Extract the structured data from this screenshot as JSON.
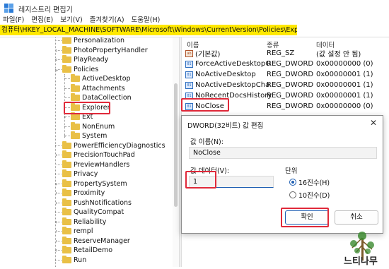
{
  "window": {
    "title": "레지스트리 편집기"
  },
  "menu": [
    "파일(F)",
    "편집(E)",
    "보기(V)",
    "즐겨찾기(A)",
    "도움말(H)"
  ],
  "address": "컴퓨터\\HKEY_LOCAL_MACHINE\\SOFTWARE\\Microsoft\\Windows\\CurrentVersion\\Policies\\Explorer",
  "tree": {
    "items": [
      {
        "label": "Personalization",
        "expander": ""
      },
      {
        "label": "PhotoPropertyHandler",
        "expander": ">"
      },
      {
        "label": "PlayReady",
        "expander": ">"
      },
      {
        "label": "Policies",
        "expander": "v"
      },
      {
        "label": "ActiveDesktop",
        "expander": ""
      },
      {
        "label": "Attachments",
        "expander": ""
      },
      {
        "label": "DataCollection",
        "expander": ""
      },
      {
        "label": "Explorer",
        "expander": ""
      },
      {
        "label": "Ext",
        "expander": ">"
      },
      {
        "label": "NonEnum",
        "expander": ""
      },
      {
        "label": "System",
        "expander": ">"
      },
      {
        "label": "PowerEfficiencyDiagnostics",
        "expander": ""
      },
      {
        "label": "PrecisionTouchPad",
        "expander": ">"
      },
      {
        "label": "PreviewHandlers",
        "expander": ""
      },
      {
        "label": "Privacy",
        "expander": ""
      },
      {
        "label": "PropertySystem",
        "expander": ">"
      },
      {
        "label": "Proximity",
        "expander": ">"
      },
      {
        "label": "PushNotifications",
        "expander": ">"
      },
      {
        "label": "QualityCompat",
        "expander": ""
      },
      {
        "label": "Reliability",
        "expander": ">"
      },
      {
        "label": "rempl",
        "expander": ">"
      },
      {
        "label": "ReserveManager",
        "expander": ">"
      },
      {
        "label": "RetailDemo",
        "expander": ">"
      },
      {
        "label": "Run",
        "expander": ""
      }
    ]
  },
  "list": {
    "headers": {
      "name": "이름",
      "type": "종류",
      "data": "데이터"
    },
    "rows": [
      {
        "name": "(기본값)",
        "type": "REG_SZ",
        "data": "(값 설정 안 됨)",
        "icon": "string-value-icon"
      },
      {
        "name": "ForceActiveDesktopOn",
        "type": "REG_DWORD",
        "data": "0x00000000 (0)",
        "icon": "dword-value-icon"
      },
      {
        "name": "NoActiveDesktop",
        "type": "REG_DWORD",
        "data": "0x00000001 (1)",
        "icon": "dword-value-icon"
      },
      {
        "name": "NoActiveDesktopCha...",
        "type": "REG_DWORD",
        "data": "0x00000001 (1)",
        "icon": "dword-value-icon"
      },
      {
        "name": "NoRecentDocsHistory",
        "type": "REG_DWORD",
        "data": "0x00000001 (1)",
        "icon": "dword-value-icon"
      },
      {
        "name": "NoClose",
        "type": "REG_DWORD",
        "data": "0x00000000 (0)",
        "icon": "dword-value-icon"
      }
    ]
  },
  "dialog": {
    "title": "DWORD(32비트) 값 편집",
    "close": "✕",
    "name_label": "값 이름(N):",
    "name_value": "NoClose",
    "data_label": "값 데이터(V):",
    "data_value": "1",
    "base_label": "단위",
    "radio_hex": "16진수(H)",
    "radio_dec": "10진수(D)",
    "selected_base": "16진수(H)",
    "ok": "확인",
    "cancel": "취소"
  },
  "watermark": "느티나무",
  "colors": {
    "highlight": "#ffe800",
    "annotation": "#e0293a",
    "folder": "#e9c046",
    "accent": "#1f5fb3"
  }
}
